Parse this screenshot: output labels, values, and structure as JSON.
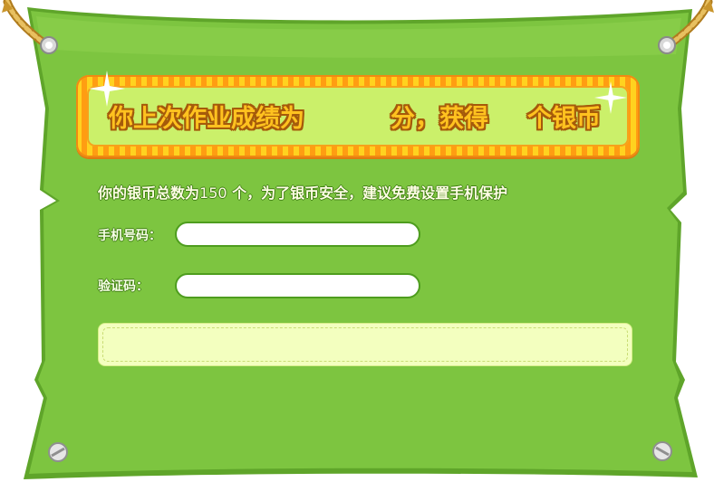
{
  "banner": {
    "part1": "你上次作业成绩为",
    "part2": "分，获得",
    "part3": "个银币"
  },
  "info": {
    "prefix": "你的银币总数为",
    "amount": "150",
    "suffix": " 个，为了银币安全，建议免费设置手机保护"
  },
  "form": {
    "phone_label": "手机号码：",
    "phone_value": "",
    "code_label": "验证码：",
    "code_value": ""
  },
  "message": "",
  "colors": {
    "board": "#7dc540",
    "board_edge": "#5fa52a",
    "banner_fill": "#cbf06a",
    "banner_stripes": "#ffd21f",
    "title_text": "#ffc21f"
  }
}
